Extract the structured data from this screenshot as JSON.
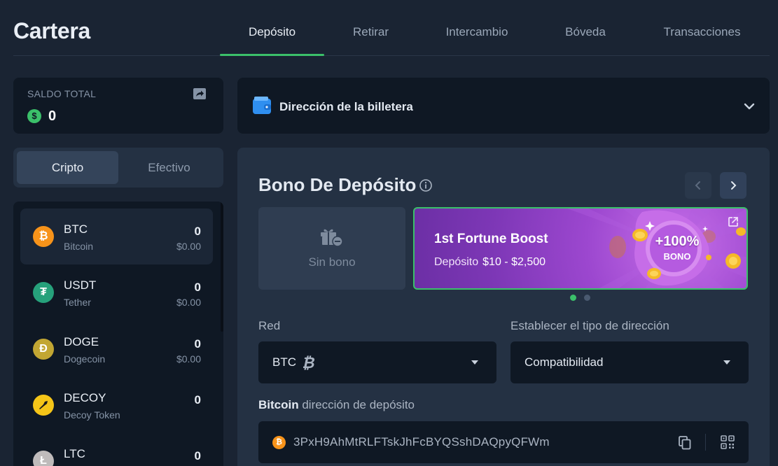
{
  "app": {
    "title": "Cartera"
  },
  "tabs": [
    {
      "label": "Depósito",
      "active": true
    },
    {
      "label": "Retirar",
      "active": false
    },
    {
      "label": "Intercambio",
      "active": false
    },
    {
      "label": "Bóveda",
      "active": false
    },
    {
      "label": "Transacciones",
      "active": false
    }
  ],
  "balance": {
    "label": "SALDO TOTAL",
    "currency_icon": "dollar-icon",
    "value": "0"
  },
  "switch": {
    "crypto": "Cripto",
    "cash": "Efectivo",
    "active": "crypto"
  },
  "coins": [
    {
      "symbol": "BTC",
      "name": "Bitcoin",
      "amount": "0",
      "usd": "$0.00",
      "color": "#f7931a",
      "glyph": "₿",
      "selected": true
    },
    {
      "symbol": "USDT",
      "name": "Tether",
      "amount": "0",
      "usd": "$0.00",
      "color": "#26a17b",
      "glyph": "₮",
      "selected": false
    },
    {
      "symbol": "DOGE",
      "name": "Dogecoin",
      "amount": "0",
      "usd": "$0.00",
      "color": "#c2a633",
      "glyph": "Ð",
      "selected": false
    },
    {
      "symbol": "DECOY",
      "name": "Decoy Token",
      "amount": "0",
      "usd": "",
      "color": "#f5c518",
      "glyph": "🦆",
      "selected": false
    },
    {
      "symbol": "LTC",
      "name": "",
      "amount": "0",
      "usd": "",
      "color": "#bfbbbb",
      "glyph": "Ł",
      "selected": false
    }
  ],
  "wallet": {
    "title": "Dirección de la billetera"
  },
  "bonus": {
    "title": "Bono De Depósito",
    "none_label": "Sin bono",
    "promo": {
      "title": "1st Fortune Boost",
      "deposit_label": "Depósito",
      "range": "$10 - $2,500",
      "badge_pct": "+100%",
      "badge_word": "BONO"
    },
    "slides": 2,
    "active_slide": 0
  },
  "network": {
    "label": "Red",
    "value": "BTC"
  },
  "address_type": {
    "label": "Establecer el tipo de dirección",
    "value": "Compatibilidad"
  },
  "deposit_address": {
    "label_strong": "Bitcoin",
    "label_rest": " dirección de depósito",
    "value": "3PxH9AhMtRLFTskJhFcBYQSshDAQpyQFWm"
  },
  "colors": {
    "accent": "#3bc06a",
    "bg": "#1a2433",
    "card": "#0f1824",
    "panel": "#243143",
    "promo": "#9c47cf"
  }
}
